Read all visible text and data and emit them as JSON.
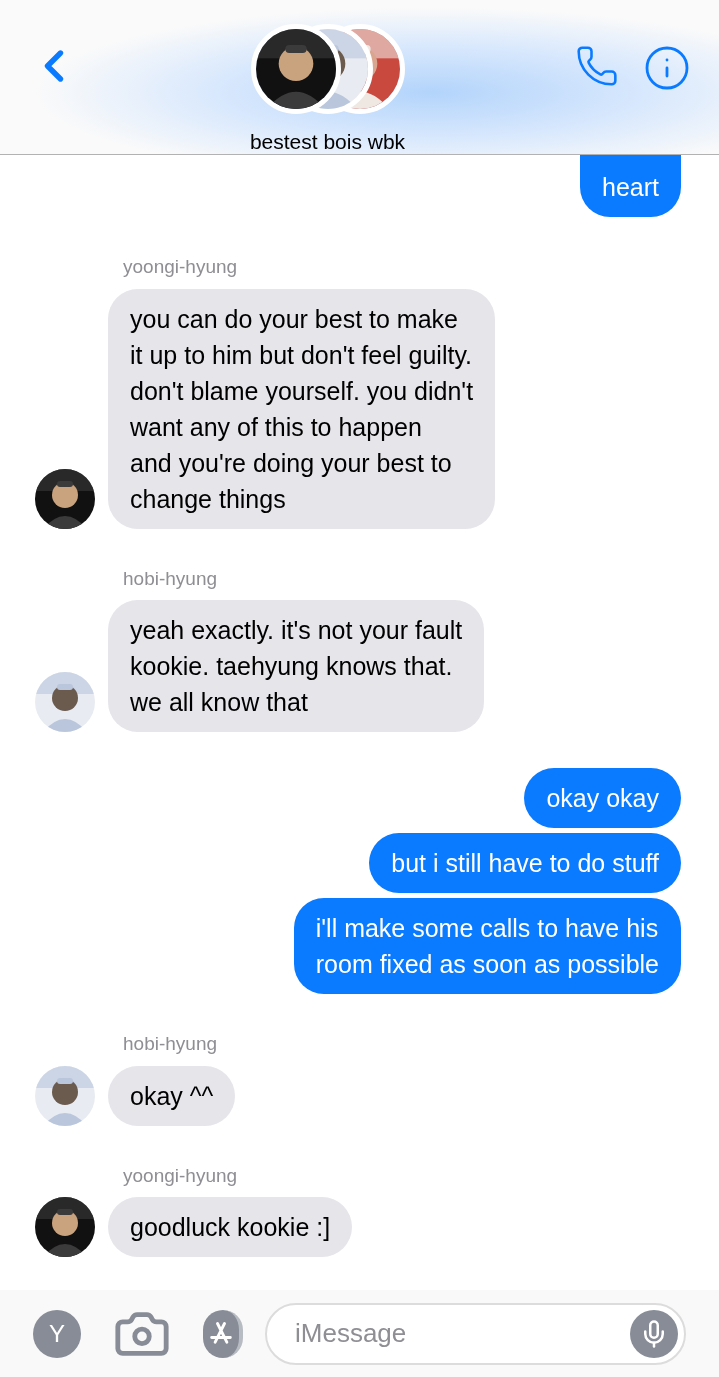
{
  "header": {
    "title": "bestest bois wbk"
  },
  "groups": [
    {
      "kind": "sent",
      "messages": [
        "heart"
      ]
    },
    {
      "kind": "received",
      "sender": "yoongi-hyung",
      "messages": [
        "you can do your best to make\nit up to him but don't feel guilty.\ndon't blame yourself. you didn't\nwant any of this to happen\nand you're doing your best to\nchange things"
      ]
    },
    {
      "kind": "received",
      "sender": "hobi-hyung",
      "messages": [
        "yeah exactly. it's not your fault\nkookie. taehyung knows that.\nwe all know that"
      ]
    },
    {
      "kind": "sent",
      "messages": [
        "okay okay",
        "but i still have to do stuff",
        "i'll make some calls to have his\nroom fixed as soon as possible"
      ]
    },
    {
      "kind": "received",
      "sender": "hobi-hyung",
      "messages": [
        "okay ^^"
      ]
    },
    {
      "kind": "received",
      "sender": "yoongi-hyung",
      "messages": [
        "goodluck kookie :]"
      ]
    }
  ],
  "input_bar": {
    "profile_letter": "Y",
    "placeholder": "iMessage"
  }
}
